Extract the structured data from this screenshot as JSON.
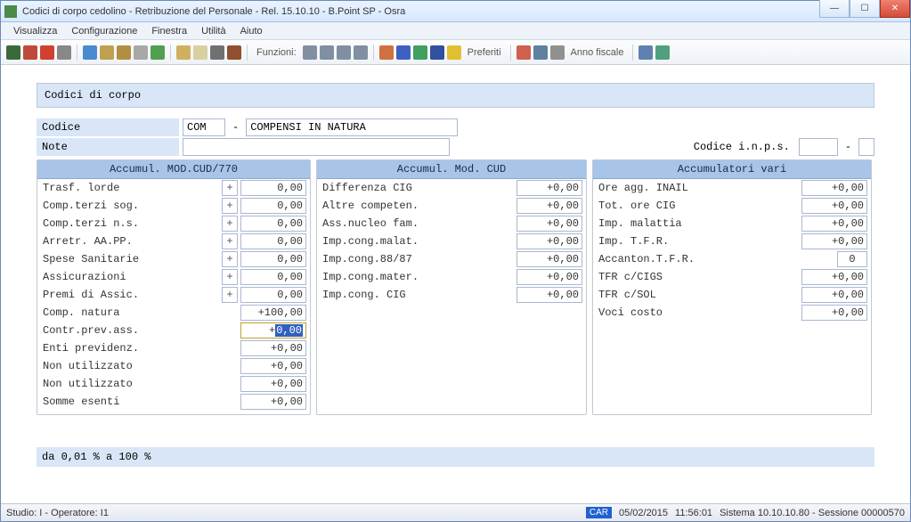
{
  "window": {
    "title": "Codici di corpo cedolino - Retribuzione del Personale - Rel. 15.10.10 - B.Point SP - Osra"
  },
  "menu": {
    "items": [
      "Visualizza",
      "Configurazione",
      "Finestra",
      "Utilità",
      "Aiuto"
    ]
  },
  "toolbar": {
    "funzioni_label": "Funzioni:",
    "preferiti_label": "Preferiti",
    "anno_fiscale_label": "Anno fiscale"
  },
  "page": {
    "title": "Codici di corpo",
    "codice_label": "Codice",
    "codice_value": "COM",
    "codice_sep": "-",
    "codice_desc": "COMPENSI IN NATURA",
    "note_label": "Note",
    "note_value": "",
    "codice_inps_label": "Codice i.n.p.s.",
    "codice_inps_value": "",
    "codice_inps_sep": "-"
  },
  "columns": {
    "col1": {
      "header": "Accumul. MOD.CUD/770",
      "rows": [
        {
          "label": "Trasf. lorde",
          "plus": "+",
          "value": "0,00"
        },
        {
          "label": "Comp.terzi sog.",
          "plus": "+",
          "value": "0,00"
        },
        {
          "label": "Comp.terzi n.s.",
          "plus": "+",
          "value": "0,00"
        },
        {
          "label": "Arretr. AA.PP.",
          "plus": "+",
          "value": "0,00"
        },
        {
          "label": "Spese Sanitarie",
          "plus": "+",
          "value": "0,00"
        },
        {
          "label": "Assicurazioni",
          "plus": "+",
          "value": "0,00"
        },
        {
          "label": "Premi di Assic.",
          "plus": "+",
          "value": "0,00"
        },
        {
          "label": "Comp. natura",
          "plus": "",
          "value": "+100,00"
        },
        {
          "label": "Contr.prev.ass.",
          "plus": "",
          "value_prefix": "+",
          "value_sel": "0,00",
          "active": true
        },
        {
          "label": "Enti previdenz.",
          "plus": "",
          "value": "+0,00"
        },
        {
          "label": "Non utilizzato",
          "plus": "",
          "value": "+0,00"
        },
        {
          "label": "Non utilizzato",
          "plus": "",
          "value": "+0,00"
        },
        {
          "label": "Somme esenti",
          "plus": "",
          "value": "+0,00"
        }
      ]
    },
    "col2": {
      "header": "Accumul. Mod. CUD",
      "rows": [
        {
          "label": "Differenza CIG",
          "value": "+0,00"
        },
        {
          "label": "Altre competen.",
          "value": "+0,00"
        },
        {
          "label": "Ass.nucleo fam.",
          "value": "+0,00"
        },
        {
          "label": "Imp.cong.malat.",
          "value": "+0,00"
        },
        {
          "label": "Imp.cong.88/87",
          "value": "+0,00"
        },
        {
          "label": "Imp.cong.mater.",
          "value": "+0,00"
        },
        {
          "label": "Imp.cong. CIG",
          "value": "+0,00"
        }
      ]
    },
    "col3": {
      "header": "Accumulatori vari",
      "rows": [
        {
          "label": "Ore agg. INAIL",
          "value": "+0,00"
        },
        {
          "label": "Tot. ore CIG",
          "value": "+0,00"
        },
        {
          "label": "Imp. malattia",
          "value": "+0,00"
        },
        {
          "label": "Imp. T.F.R.",
          "value": "+0,00"
        },
        {
          "label": "Accanton.T.F.R.",
          "value": "0",
          "small": true
        },
        {
          "label": "TFR c/CIGS",
          "value": "+0,00"
        },
        {
          "label": "TFR c/SOL",
          "value": "+0,00"
        },
        {
          "label": "Voci costo",
          "value": "+0,00"
        }
      ]
    }
  },
  "footer_hint": "da 0,01 % a 100 %",
  "statusbar": {
    "left": "Studio: I - Operatore: I1",
    "car": "CAR",
    "date": "05/02/2015",
    "time": "11:56:01",
    "right": "Sistema 10.10.10.80 - Sessione 00000570"
  }
}
